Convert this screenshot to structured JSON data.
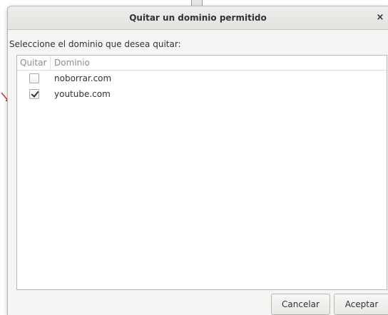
{
  "dialog": {
    "title": "Quitar un dominio permitido",
    "close_symbol": "×",
    "prompt": "Seleccione el dominio que desea quitar:"
  },
  "list": {
    "headers": {
      "remove": "Quitar",
      "domain": "Dominio"
    },
    "rows": [
      {
        "checked": false,
        "domain": "noborrar.com"
      },
      {
        "checked": true,
        "domain": "youtube.com"
      }
    ]
  },
  "buttons": {
    "cancel": "Cancelar",
    "accept": "Aceptar"
  }
}
